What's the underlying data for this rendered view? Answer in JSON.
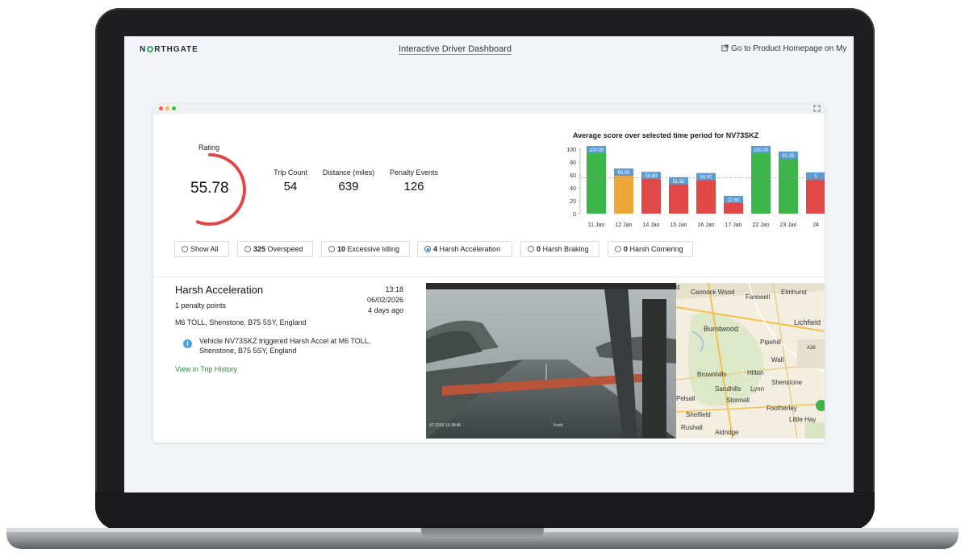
{
  "header": {
    "brand_left": "N",
    "brand_right": "RTHGATE",
    "title": "Interactive Driver Dashboard",
    "homepage_link": "Go to Product Homepage on My"
  },
  "summary": {
    "rating_label": "Rating",
    "rating_value": "55.78",
    "rating_fraction": 0.5578,
    "stats": [
      {
        "label": "Trip Count",
        "value": "54"
      },
      {
        "label": "Distance (miles)",
        "value": "639"
      },
      {
        "label": "Penalty Events",
        "value": "126"
      }
    ]
  },
  "chart_data": {
    "type": "bar",
    "title": "Average score over selected time period for NV73SKZ",
    "categories": [
      "11 Jan",
      "12 Jan",
      "14 Jan",
      "15 Jan",
      "16 Jan",
      "17 Jan",
      "22 Jan",
      "23 Jan",
      "24"
    ],
    "values": [
      100.0,
      65.0,
      59.8,
      51.5,
      58.0,
      22.6,
      100.0,
      91.25,
      59.0
    ],
    "labels": [
      "100.00",
      "65.00",
      "59.80",
      "51.50",
      "58.00",
      "22.60",
      "100.00",
      "91.25",
      "5"
    ],
    "bar_colors": [
      "#3cb54a",
      "#f0a73a",
      "#e04848",
      "#e04848",
      "#e04848",
      "#e04848",
      "#3cb54a",
      "#3cb54a",
      "#e04848"
    ],
    "label_color": "#5b9bd5",
    "yticks": [
      "100",
      "80",
      "60",
      "40",
      "20",
      "0"
    ],
    "ylim": [
      0,
      100
    ],
    "reference_line": 55.78
  },
  "filters": [
    {
      "count": "",
      "label": "Show All",
      "selected": false
    },
    {
      "count": "325",
      "label": "Overspeed",
      "selected": false
    },
    {
      "count": "10",
      "label": "Excessive Idling",
      "selected": false
    },
    {
      "count": "4",
      "label": "Harsh Acceleration",
      "selected": true
    },
    {
      "count": "0",
      "label": "Harsh Braking",
      "selected": false
    },
    {
      "count": "0",
      "label": "Harsh Cornering",
      "selected": false
    }
  ],
  "event": {
    "title": "Harsh Acceleration",
    "points": "1 penalty points",
    "location": "M6 TOLL, Shenstone, B75 5SY, England",
    "time": "13:18",
    "date": "06/02/2026",
    "ago": "4 days ago",
    "description": "Vehicle NV73SKZ triggered Harsh Accel at M6 TOLL, Shenstone, B75 5SY, England",
    "trip_link": "View in Trip History"
  },
  "video": {
    "timestamp": "07-2026 13:18:46",
    "camera": "Front"
  },
  "map": {
    "places": [
      {
        "name": "Cannock Wood"
      },
      {
        "name": "Farewell"
      },
      {
        "name": "Elmhurst"
      },
      {
        "name": "Burntwood"
      },
      {
        "name": "Lichfield"
      },
      {
        "name": "Pipehill"
      },
      {
        "name": "A38"
      },
      {
        "name": "Wall"
      },
      {
        "name": "Brownhills"
      },
      {
        "name": "Hilton"
      },
      {
        "name": "Shenstone"
      },
      {
        "name": "Sandhills"
      },
      {
        "name": "Lynn"
      },
      {
        "name": "Pelsall"
      },
      {
        "name": "Stonnall"
      },
      {
        "name": "Footherley"
      },
      {
        "name": "Shelfield"
      },
      {
        "name": "Little Hay"
      },
      {
        "name": "Rushall"
      },
      {
        "name": "Aldridge"
      },
      {
        "name": "d"
      }
    ]
  }
}
